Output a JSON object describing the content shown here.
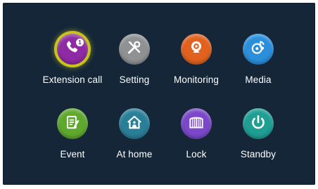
{
  "menu": {
    "items": [
      {
        "label": "Extension call",
        "icon": "phone-icon",
        "color": "#8e2aa3",
        "selected": true,
        "badge": "1"
      },
      {
        "label": "Setting",
        "icon": "tools-icon",
        "color": "#8f9193"
      },
      {
        "label": "Monitoring",
        "icon": "camera-icon",
        "color": "#e0621e"
      },
      {
        "label": "Media",
        "icon": "music-disc-icon",
        "color": "#2b8fdb"
      },
      {
        "label": "Event",
        "icon": "note-icon",
        "color": "#5fa82e"
      },
      {
        "label": "At home",
        "icon": "home-icon",
        "color": "#2a7f98"
      },
      {
        "label": "Lock",
        "icon": "gate-icon",
        "color": "#7a48c8"
      },
      {
        "label": "Standby",
        "icon": "power-icon",
        "color": "#1f9e94"
      }
    ]
  }
}
